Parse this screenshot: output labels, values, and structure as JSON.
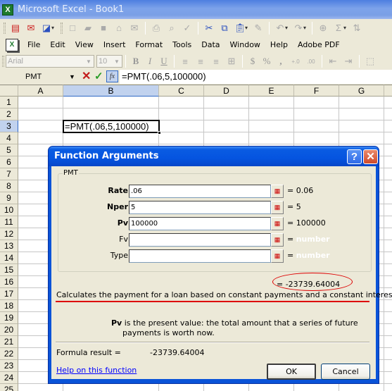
{
  "window": {
    "title": "Microsoft Excel - Book1",
    "app_icon": "excel-icon"
  },
  "standard_toolbar": {
    "icons": [
      "pdf-convert-icon",
      "pdf-email-icon",
      "pdf-review-icon",
      "new-icon",
      "open-icon",
      "save-icon",
      "permission-icon",
      "email-icon",
      "print-icon",
      "print-preview-icon",
      "spelling-icon",
      "cut-icon",
      "copy-icon",
      "paste-icon",
      "format-painter-icon",
      "undo-icon",
      "redo-icon",
      "hyperlink-icon",
      "autosum-icon",
      "sort-ascending-icon"
    ]
  },
  "menubar": {
    "items": [
      {
        "label": "File",
        "accel": "F"
      },
      {
        "label": "Edit",
        "accel": "E"
      },
      {
        "label": "View",
        "accel": "V"
      },
      {
        "label": "Insert",
        "accel": "I"
      },
      {
        "label": "Format",
        "accel": "o"
      },
      {
        "label": "Tools",
        "accel": "T"
      },
      {
        "label": "Data",
        "accel": "D"
      },
      {
        "label": "Window",
        "accel": "W"
      },
      {
        "label": "Help",
        "accel": "H"
      },
      {
        "label": "Adobe PDF",
        "accel": "b"
      }
    ]
  },
  "formatting_toolbar": {
    "font": "Arial",
    "size": "10",
    "bold": "B",
    "italic": "I",
    "underline": "U",
    "currency": "$",
    "percent": "%",
    "comma": ","
  },
  "formula_bar": {
    "name_box": "PMT",
    "cancel": "✕",
    "enter": "✓",
    "fx": "fx",
    "formula": "=PMT(.06,5,100000)"
  },
  "sheet": {
    "columns": [
      "A",
      "B",
      "C",
      "D",
      "E",
      "F",
      "G"
    ],
    "selected_column": "B",
    "rows": [
      "1",
      "2",
      "3",
      "4",
      "5",
      "6",
      "7",
      "8",
      "9",
      "10",
      "11",
      "12",
      "13",
      "14",
      "15",
      "16",
      "17",
      "18",
      "19",
      "20",
      "21",
      "22",
      "23",
      "24",
      "25"
    ],
    "selected_row": "3",
    "active_cell": {
      "ref": "B3",
      "content": "=PMT(.06,5,100000)"
    }
  },
  "dialog": {
    "title": "Function Arguments",
    "help_button": "?",
    "close_button": "✕",
    "function_name": "PMT",
    "arguments": [
      {
        "label": "Rate",
        "required": true,
        "value": ".06",
        "result": "0.06",
        "placeholder": false
      },
      {
        "label": "Nper",
        "required": true,
        "value": "5",
        "result": "5",
        "placeholder": false
      },
      {
        "label": "Pv",
        "required": true,
        "value": "100000",
        "result": "100000",
        "placeholder": false
      },
      {
        "label": "Fv",
        "required": false,
        "value": "",
        "result": "number",
        "placeholder": true
      },
      {
        "label": "Type",
        "required": false,
        "value": "",
        "result": "number",
        "placeholder": true
      }
    ],
    "function_result": "= -23739.64004",
    "description": "Calculates the payment for a loan based on constant payments and a constant interest rate.",
    "param_name": "Pv",
    "param_description": "is the present value: the total amount that a series of future payments is worth now.",
    "formula_result_label": "Formula result =",
    "formula_result_value": "-23739.64004",
    "help_link": "Help on this function",
    "ok_label": "OK",
    "cancel_label": "Cancel",
    "annotation_color": "#dd0000"
  }
}
